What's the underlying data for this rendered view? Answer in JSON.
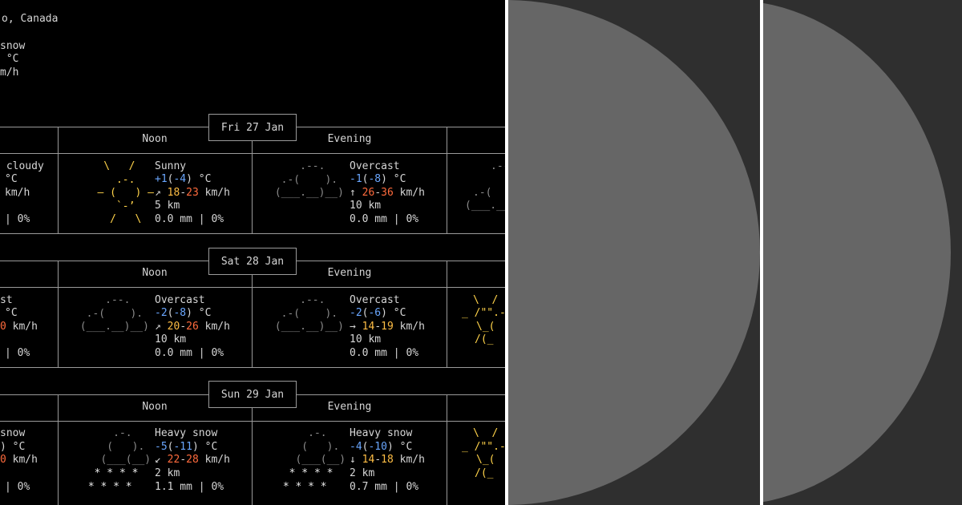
{
  "location": {
    "line1": "o, Canada",
    "line2": "snow",
    "line3": " °C",
    "line4": "m/h"
  },
  "days": [
    {
      "date": "Fri 27 Jan",
      "left_partial": {
        "condition": " cloudy",
        "temp": "°C",
        "wind": "km/h",
        "precip": "| 0%"
      },
      "periods": [
        {
          "label": "Noon",
          "condition": "Sunny",
          "temp_main": "+1",
          "temp_feels": "-4",
          "wind_arrow": "↗",
          "wind_lo": "18",
          "wind_hi": "23",
          "visibility": "5 km",
          "precip": "0.0 mm | 0%"
        },
        {
          "label": "Evening",
          "condition": "Overcast",
          "temp_main": "-1",
          "temp_feels": "-8",
          "wind_arrow": "↑",
          "wind_lo": "26",
          "wind_hi": "36",
          "visibility": "10 km",
          "precip": "0.0 mm | 0%"
        }
      ]
    },
    {
      "date": "Sat 28 Jan",
      "left_partial": {
        "condition": "st",
        "temp": "°C",
        "wind": "0 km/h",
        "precip": "| 0%"
      },
      "periods": [
        {
          "label": "Noon",
          "condition": "Overcast",
          "temp_main": "-2",
          "temp_feels": "-8",
          "wind_arrow": "↗",
          "wind_lo": "20",
          "wind_hi": "26",
          "visibility": "10 km",
          "precip": "0.0 mm | 0%"
        },
        {
          "label": "Evening",
          "condition": "Overcast",
          "temp_main": "-2",
          "temp_feels": "-6",
          "wind_arrow": "→",
          "wind_lo": "14",
          "wind_hi": "19",
          "visibility": "10 km",
          "precip": "0.0 mm | 0%"
        }
      ]
    },
    {
      "date": "Sun 29 Jan",
      "left_partial": {
        "condition": "snow",
        "temp": ") °C",
        "wind": "0 km/h",
        "precip": "| 0%"
      },
      "periods": [
        {
          "label": "Noon",
          "condition": "Heavy snow",
          "temp_main": "-5",
          "temp_feels": "-11",
          "wind_arrow": "↙",
          "wind_lo": "22",
          "wind_hi": "28",
          "visibility": "2 km",
          "precip": "1.1 mm | 0%"
        },
        {
          "label": "Evening",
          "condition": "Heavy snow",
          "temp_main": "-4",
          "temp_feels": "-10",
          "wind_arrow": "↓",
          "wind_lo": "14",
          "wind_hi": "18",
          "visibility": "2 km",
          "precip": "0.7 mm | 0%"
        }
      ]
    }
  ],
  "right_art": {
    "fri_cloud_top": ".--",
    "fri_cloud_mid": ".-(",
    "fri_cloud_bot": "(___.__",
    "sat_sun_1": "\\  /",
    "sat_sun_2": "_ /\"\".-",
    "sat_sun_3": "\\_(",
    "sat_sun_4": "/(_",
    "sun_sun_1": "\\  /",
    "sun_sun_2": "_ /\"\".-",
    "sun_sun_3": "\\_(",
    "sun_sun_4": "/(_"
  },
  "colors": {
    "terminal_bg": "#000000",
    "panel_bg": "#2f2f2f",
    "moon": "#666666"
  }
}
